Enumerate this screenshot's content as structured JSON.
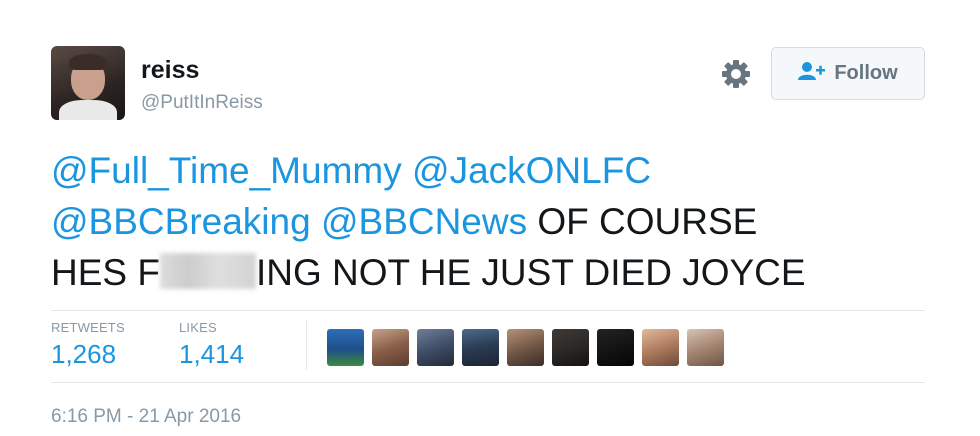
{
  "user": {
    "display_name": "reiss",
    "handle": "@PutItInReiss"
  },
  "header": {
    "settings_icon": "gear-icon",
    "follow_icon": "add-user-icon",
    "follow_label": "Follow"
  },
  "tweet": {
    "mention_1": "@Full_Time_Mummy",
    "mention_2": "@JackONLFC",
    "mention_3": "@BBCBreaking",
    "mention_4": "@BBCNews",
    "text_1": " OF COURSE",
    "text_2": "HES F",
    "text_3": "ING NOT HE JUST DIED JOYCE"
  },
  "stats": {
    "retweets_label": "RETWEETS",
    "retweets_value": "1,268",
    "likes_label": "LIKES",
    "likes_value": "1,414"
  },
  "timestamp": "6:16 PM - 21 Apr 2016",
  "colors": {
    "link": "#1b95e0",
    "secondary_text": "#8899a6",
    "divider": "#e1e8ed"
  }
}
